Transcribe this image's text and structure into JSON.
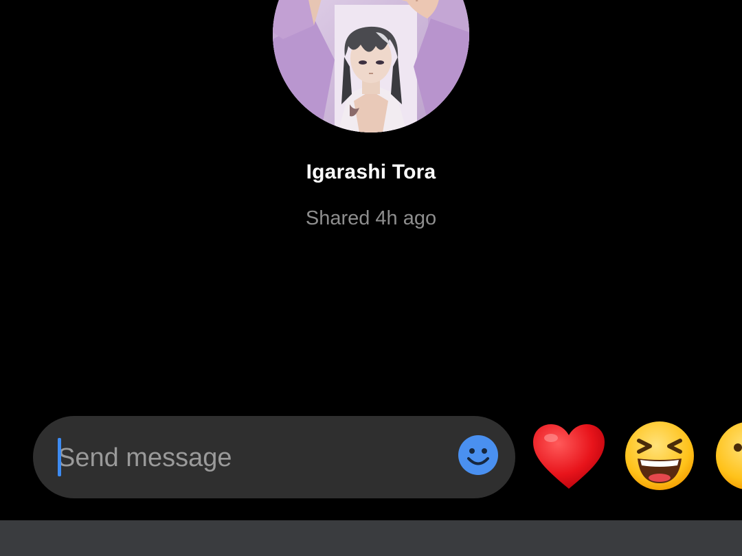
{
  "story": {
    "sender_name": "Igarashi Tora",
    "shared_time": "Shared 4h ago"
  },
  "composer": {
    "placeholder": "Send message",
    "value": ""
  },
  "reactions": [
    {
      "name": "heart",
      "emoji": "❤️"
    },
    {
      "name": "laughing",
      "emoji": "😆"
    },
    {
      "name": "surprised",
      "emoji": "😮"
    }
  ],
  "colors": {
    "background": "#000000",
    "composer_bg": "#2f2f2f",
    "accent": "#3d8bf2",
    "secondary_text": "#8e8e8e",
    "nav_bar": "#3a3c3f"
  }
}
